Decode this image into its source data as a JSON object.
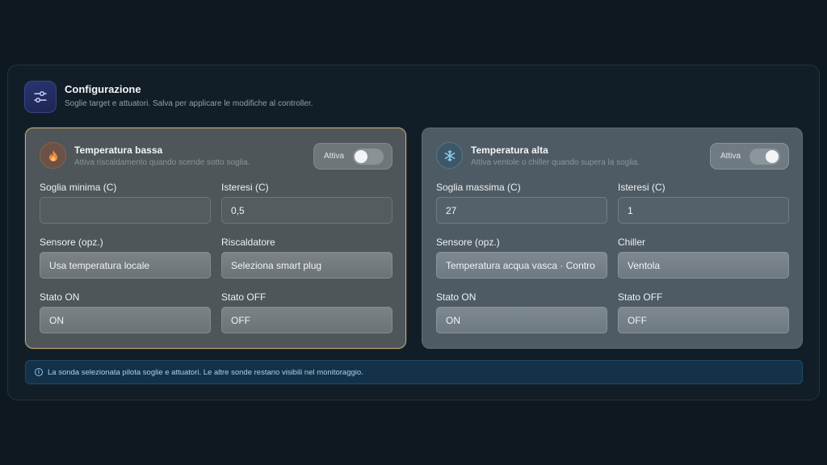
{
  "header": {
    "title": "Configurazione",
    "subtitle": "Soglie target e attuatori. Salva per applicare le modifiche al controller.",
    "icon": "sliders-icon"
  },
  "low_panel": {
    "icon": "flame-icon",
    "title": "Temperatura bassa",
    "subtitle": "Attiva riscaldamento quando scende sotto soglia.",
    "toggle_label": "Attiva",
    "toggle_on": false,
    "threshold_label": "Soglia minima (C)",
    "threshold_value": "",
    "hysteresis_label": "Isteresi (C)",
    "hysteresis_value": "0,5",
    "sensor_label": "Sensore (opz.)",
    "sensor_value": "Usa temperatura locale",
    "actuator_label": "Riscaldatore",
    "actuator_value": "Seleziona smart plug",
    "state_on_label": "Stato ON",
    "state_on_value": "ON",
    "state_off_label": "Stato OFF",
    "state_off_value": "OFF"
  },
  "high_panel": {
    "icon": "snowflake-icon",
    "title": "Temperatura alta",
    "subtitle": "Attiva ventole o chiller quando supera la soglia.",
    "toggle_label": "Attiva",
    "toggle_on": true,
    "threshold_label": "Soglia massima (C)",
    "threshold_value": "27",
    "hysteresis_label": "Isteresi (C)",
    "hysteresis_value": "1",
    "sensor_label": "Sensore (opz.)",
    "sensor_value": "Temperatura acqua vasca · Contro",
    "actuator_label": "Chiller",
    "actuator_value": "Ventola",
    "state_on_label": "Stato ON",
    "state_on_value": "ON",
    "state_off_label": "Stato OFF",
    "state_off_value": "OFF"
  },
  "info": {
    "icon": "info-icon",
    "text": "La sonda selezionata pilota soglie e attuatori. Le altre sonde restano visibili nel monitoraggio."
  },
  "colors": {
    "background": "#0d1820",
    "low_accent": "#c8a878",
    "info_bg": "#13324a",
    "info_text": "#a9cfe8"
  }
}
